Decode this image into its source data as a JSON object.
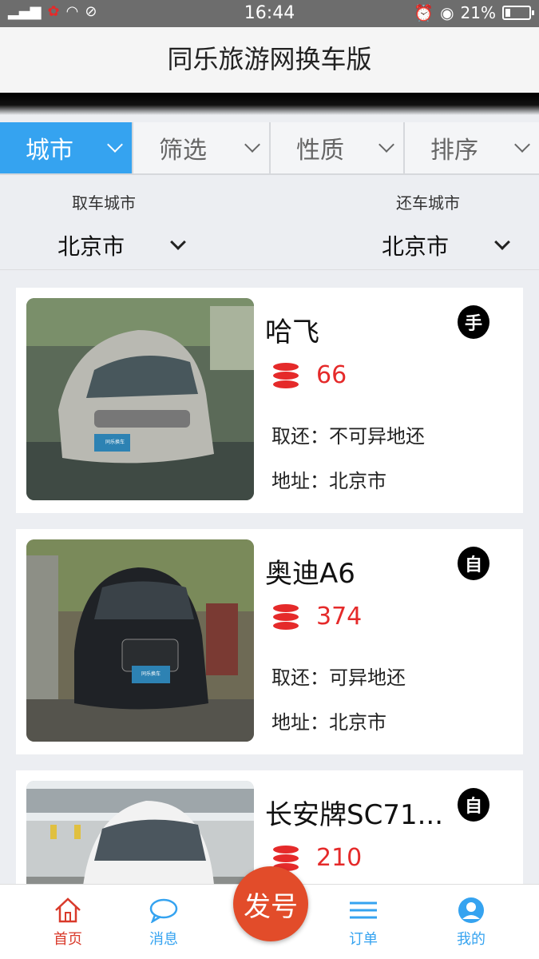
{
  "status_bar": {
    "time": "16:44",
    "battery": "21%"
  },
  "header": {
    "title": "同乐旅游网换车版"
  },
  "filter_tabs": [
    {
      "label": "城市",
      "active": true
    },
    {
      "label": "筛选",
      "active": false
    },
    {
      "label": "性质",
      "active": false
    },
    {
      "label": "排序",
      "active": false
    }
  ],
  "city_select": {
    "pickup_label": "取车城市",
    "pickup_value": "北京市",
    "return_label": "还车城市",
    "return_value": "北京市"
  },
  "cars": [
    {
      "name": "哈飞",
      "badge": "手",
      "price": "66",
      "return_text": "取还：不可异地还",
      "address_text": "地址：北京市",
      "photo_plate_logo": "同乐换车"
    },
    {
      "name": "奥迪A6",
      "badge": "自",
      "price": "374",
      "return_text": "取还：可异地还",
      "address_text": "地址：北京市",
      "photo_plate_logo": "同乐换车"
    },
    {
      "name": "长安牌SC71...",
      "badge": "自",
      "price": "210",
      "return_text": "",
      "address_text": ""
    }
  ],
  "bottom_nav": {
    "home_label": "首页",
    "messages_label": "消息",
    "center_button_label": "发号",
    "orders_label": "订单",
    "mine_label": "我的"
  },
  "colors": {
    "accent": "#35a3f0",
    "price_red": "#e52a2a",
    "center_button": "#e24c2a",
    "active_nav": "#d93a2b"
  }
}
